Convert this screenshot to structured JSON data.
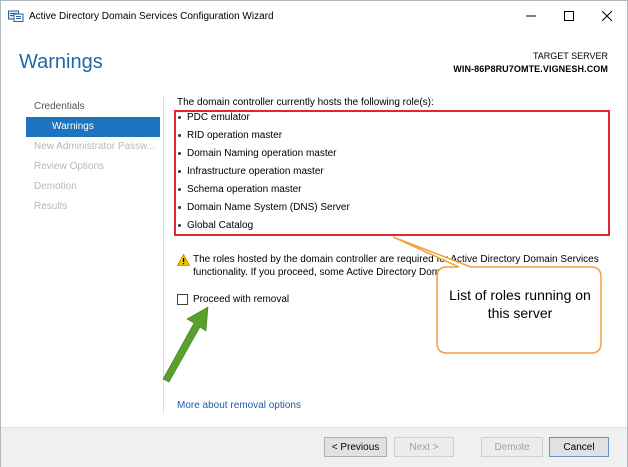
{
  "window": {
    "title": "Active Directory Domain Services Configuration Wizard",
    "icons": [
      "server-wizard-icon",
      "minimize-icon",
      "maximize-icon",
      "close-icon"
    ]
  },
  "header": {
    "page_title": "Warnings",
    "target_label": "TARGET SERVER",
    "target_name": "WIN-86P8RU7OMTE.VIGNESH.COM"
  },
  "sidebar": {
    "items": [
      {
        "label": "Credentials",
        "state": "done"
      },
      {
        "label": "Warnings",
        "state": "active"
      },
      {
        "label": "New Administrator Passw...",
        "state": "disabled"
      },
      {
        "label": "Review Options",
        "state": "disabled"
      },
      {
        "label": "Demotion",
        "state": "disabled"
      },
      {
        "label": "Results",
        "state": "disabled"
      }
    ]
  },
  "main": {
    "intro": "The domain controller currently hosts the following role(s):",
    "roles": [
      "PDC emulator",
      "RID operation master",
      "Domain Naming operation master",
      "Infrastructure operation master",
      "Schema operation master",
      "Domain Name System (DNS) Server",
      "Global Catalog"
    ],
    "warning_text": "The roles hosted by the domain controller are required for Active Directory Domain Services functionality. If you proceed, some Active Directory Domain Services will be impacted.",
    "proceed_label": "Proceed with removal",
    "proceed_checked": false,
    "more_link": "More about removal options"
  },
  "annotation": {
    "callout_text": "List of roles running on this server",
    "highlight_color": "#e3262b",
    "callout_color": "#f0a13c",
    "arrow_color": "#5aa02c"
  },
  "footer": {
    "previous": "< Previous",
    "next": "Next >",
    "demote": "Demote",
    "cancel": "Cancel"
  },
  "colors": {
    "accent": "#1e73be",
    "title_blue": "#1e6aa8",
    "link": "#1e5ca8"
  }
}
